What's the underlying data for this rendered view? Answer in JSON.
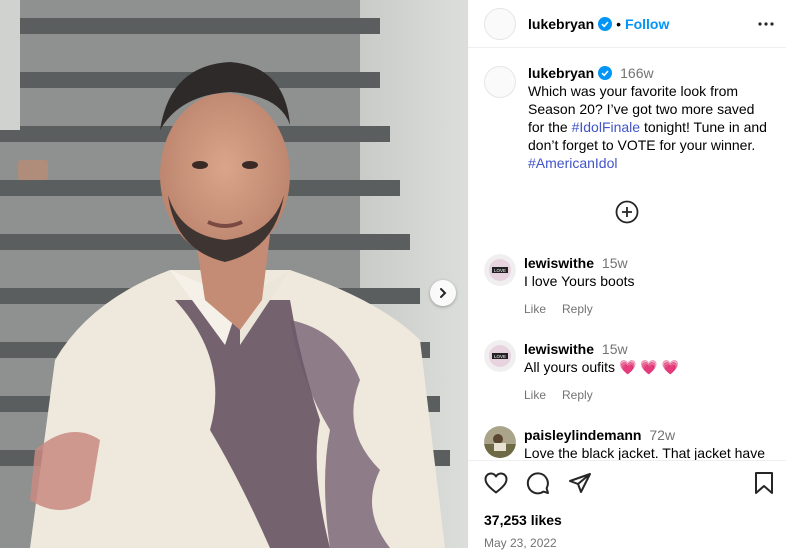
{
  "post": {
    "author": "lukebryan",
    "follow_label": "Follow",
    "dot": "•",
    "caption_author": "lukebryan",
    "caption_time": "166w",
    "caption_text_1": "Which was your favorite look from Season 20? I’ve got two more saved for the ",
    "hashtag_1": "#IdolFinale",
    "caption_text_2": " tonight! Tune in and don’t forget to VOTE for your winner. ",
    "hashtag_2": "#AmericanIdol",
    "likes": "37,253 likes",
    "date": "May 23, 2022"
  },
  "comments": [
    {
      "user": "lewiswithe",
      "time": "15w",
      "text": "I love Yours boots",
      "like": "Like",
      "reply": "Reply"
    },
    {
      "user": "lewiswithe",
      "time": "15w",
      "text": "All yours oufits",
      "emoji": "💗 💗 💗",
      "like": "Like",
      "reply": "Reply"
    },
    {
      "user": "paisleylindemann",
      "time": "72w",
      "text": "Love the black jacket. That jacket have"
    }
  ],
  "icons": [
    "verified-badge-icon",
    "more-options-icon",
    "add-circle-icon",
    "heart-icon",
    "comment-icon",
    "share-icon",
    "bookmark-icon",
    "chevron-right-icon"
  ],
  "colors": {
    "link": "#0095f6",
    "hashtag": "#4154c8",
    "muted": "#737373",
    "verified": "#0095f6"
  }
}
